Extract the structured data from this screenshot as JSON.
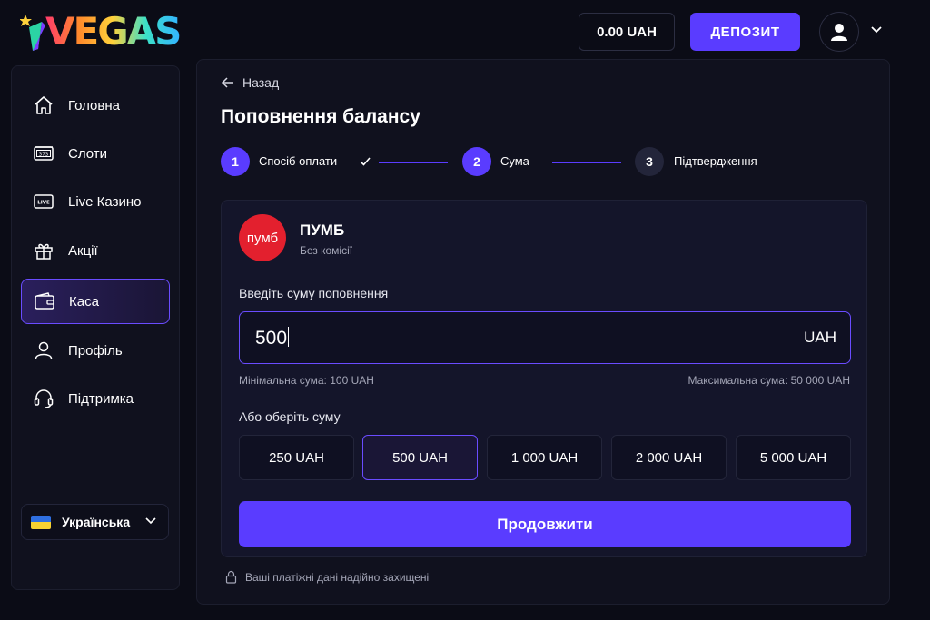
{
  "header": {
    "logo_text": "VEGAS",
    "balance": "0.00 UAH",
    "deposit_label": "ДЕПОЗИТ"
  },
  "sidebar": {
    "items": [
      {
        "label": "Головна",
        "icon": "home-icon"
      },
      {
        "label": "Слоти",
        "icon": "slot-machine-icon"
      },
      {
        "label": "Live Казино",
        "icon": "live-icon"
      },
      {
        "label": "Акції",
        "icon": "gift-icon"
      },
      {
        "label": "Каса",
        "icon": "wallet-icon",
        "active": true
      },
      {
        "label": "Профіль",
        "icon": "user-icon"
      },
      {
        "label": "Підтримка",
        "icon": "headset-icon"
      }
    ],
    "language": "Українська"
  },
  "main": {
    "back_label": "Назад",
    "title": "Поповнення балансу",
    "steps": [
      {
        "number": "1",
        "label": "Спосіб оплати",
        "state": "done"
      },
      {
        "number": "2",
        "label": "Сума",
        "state": "current"
      },
      {
        "number": "3",
        "label": "Підтвердження",
        "state": "pending"
      }
    ],
    "bank": {
      "logo_text": "пумб",
      "name": "ПУМБ",
      "subtitle": "Без комісії"
    },
    "amount_label": "Введіть суму поповнення",
    "amount_value": "500",
    "currency": "UAH",
    "min_hint": "Мінімальна сума: 100 UAH",
    "max_hint": "Максимальна сума: 50 000 UAH",
    "presets_label": "Або оберіть суму",
    "presets": [
      "250 UAH",
      "500 UAH",
      "1 000 UAH",
      "2 000 UAH",
      "5 000 UAH"
    ],
    "selected_preset": "500 UAH",
    "continue_label": "Продовжити",
    "secure_note": "Ваші платіжні дані надійно захищені"
  },
  "colors": {
    "accent": "#5a3cff",
    "background": "#0b0c16",
    "panel": "#10111e",
    "bank_brand": "#e3202e"
  }
}
